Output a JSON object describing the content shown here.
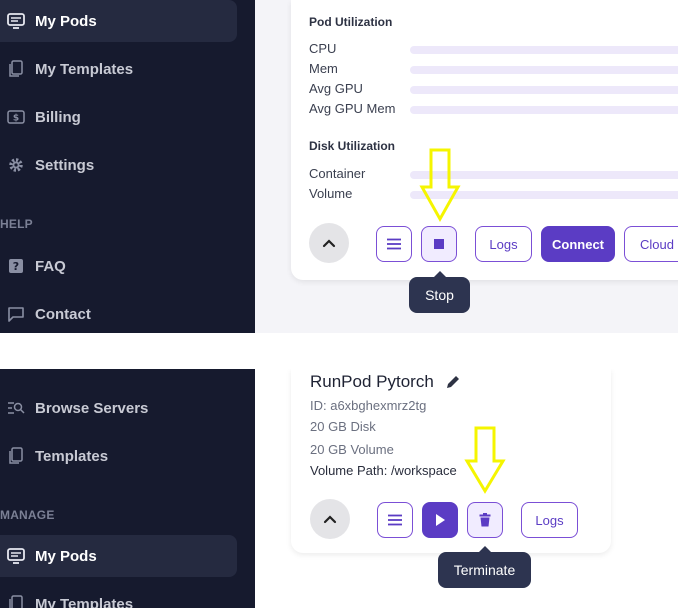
{
  "top": {
    "sidebar": {
      "items": [
        {
          "label": "My Pods",
          "icon": "pods-icon",
          "active": true
        },
        {
          "label": "My Templates",
          "icon": "templates-icon",
          "active": false
        },
        {
          "label": "Billing",
          "icon": "billing-icon",
          "active": false
        },
        {
          "label": "Settings",
          "icon": "gear-icon",
          "active": false
        }
      ],
      "help_section": "HELP",
      "help_items": [
        {
          "label": "FAQ",
          "icon": "question-icon"
        },
        {
          "label": "Contact",
          "icon": "chat-icon"
        }
      ]
    },
    "card": {
      "pod_utilization_title": "Pod Utilization",
      "pod_metrics": [
        {
          "label": "CPU",
          "value": 0
        },
        {
          "label": "Mem",
          "value": 0
        },
        {
          "label": "Avg GPU",
          "value": 0
        },
        {
          "label": "Avg GPU Mem",
          "value": 0
        }
      ],
      "disk_utilization_title": "Disk Utilization",
      "disk_metrics": [
        {
          "label": "Container",
          "value": 0
        },
        {
          "label": "Volume",
          "value": 0
        }
      ],
      "buttons": {
        "logs": "Logs",
        "connect": "Connect",
        "cloud_sync": "Cloud Sync"
      },
      "tooltip": "Stop"
    }
  },
  "bottom": {
    "sidebar": {
      "items": [
        {
          "label": "Browse Servers",
          "icon": "browse-icon"
        },
        {
          "label": "Templates",
          "icon": "templates-icon"
        }
      ],
      "manage_section": "MANAGE",
      "manage_items": [
        {
          "label": "My Pods",
          "icon": "pods-icon",
          "active": true
        },
        {
          "label": "My Templates",
          "icon": "templates-icon",
          "active": false
        }
      ]
    },
    "card": {
      "title": "RunPod Pytorch",
      "id": "ID: a6xbghexmrz2tg",
      "disk": "20 GB Disk",
      "volume": "20 GB Volume",
      "volume_path": "Volume Path: /workspace",
      "buttons": {
        "logs": "Logs"
      },
      "tooltip": "Terminate"
    }
  },
  "colors": {
    "sidebar_bg": "#161a2e",
    "accent": "#5b3cc4",
    "highlight_arrow": "#f5f500",
    "tooltip_bg": "#2d3450"
  }
}
